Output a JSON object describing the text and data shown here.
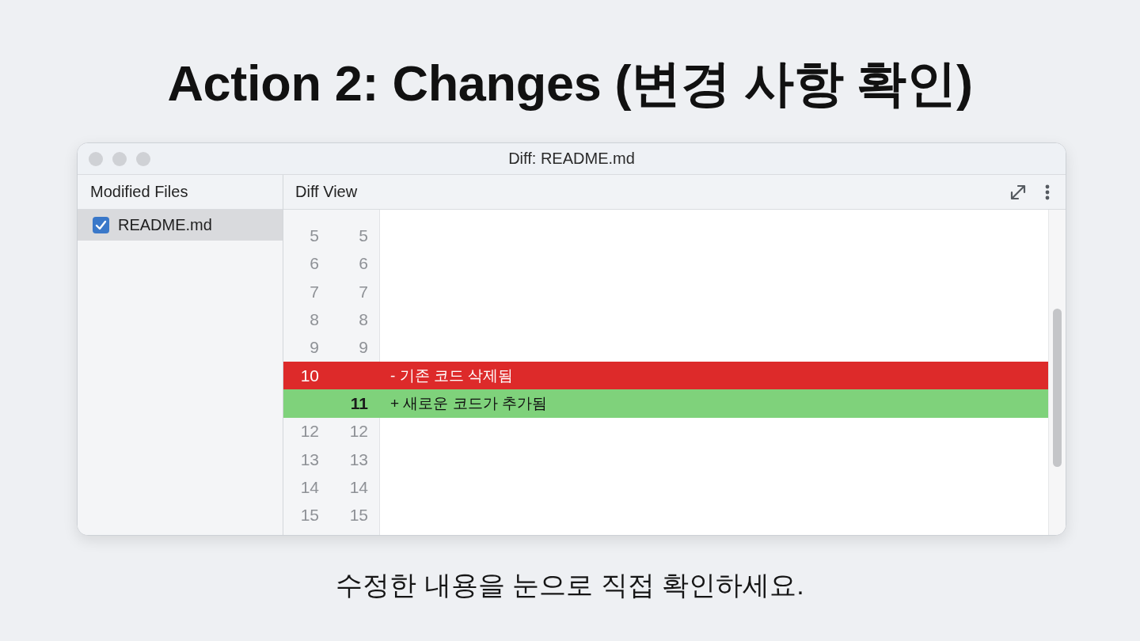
{
  "heading": "Action 2: Changes (변경 사항 확인)",
  "window": {
    "title": "Diff: README.md"
  },
  "sidebar": {
    "title": "Modified Files",
    "files": [
      {
        "name": "README.md",
        "checked": true,
        "selected": true
      }
    ]
  },
  "diff": {
    "title": "Diff View",
    "lines": [
      {
        "kind": "context",
        "old": "5",
        "new": "5"
      },
      {
        "kind": "context",
        "old": "6",
        "new": "6"
      },
      {
        "kind": "context",
        "old": "7",
        "new": "7"
      },
      {
        "kind": "context",
        "old": "8",
        "new": "8"
      },
      {
        "kind": "context",
        "old": "9",
        "new": "9"
      },
      {
        "kind": "removed",
        "old": "10",
        "text": "- 기존 코드 삭제됨"
      },
      {
        "kind": "added",
        "new": "11",
        "text": "+ 새로운 코드가 추가됨"
      },
      {
        "kind": "context",
        "old": "12",
        "new": "12"
      },
      {
        "kind": "context",
        "old": "13",
        "new": "13"
      },
      {
        "kind": "context",
        "old": "14",
        "new": "14"
      },
      {
        "kind": "context",
        "old": "15",
        "new": "15"
      }
    ]
  },
  "caption": "수정한 내용을 눈으로 직접 확인하세요."
}
